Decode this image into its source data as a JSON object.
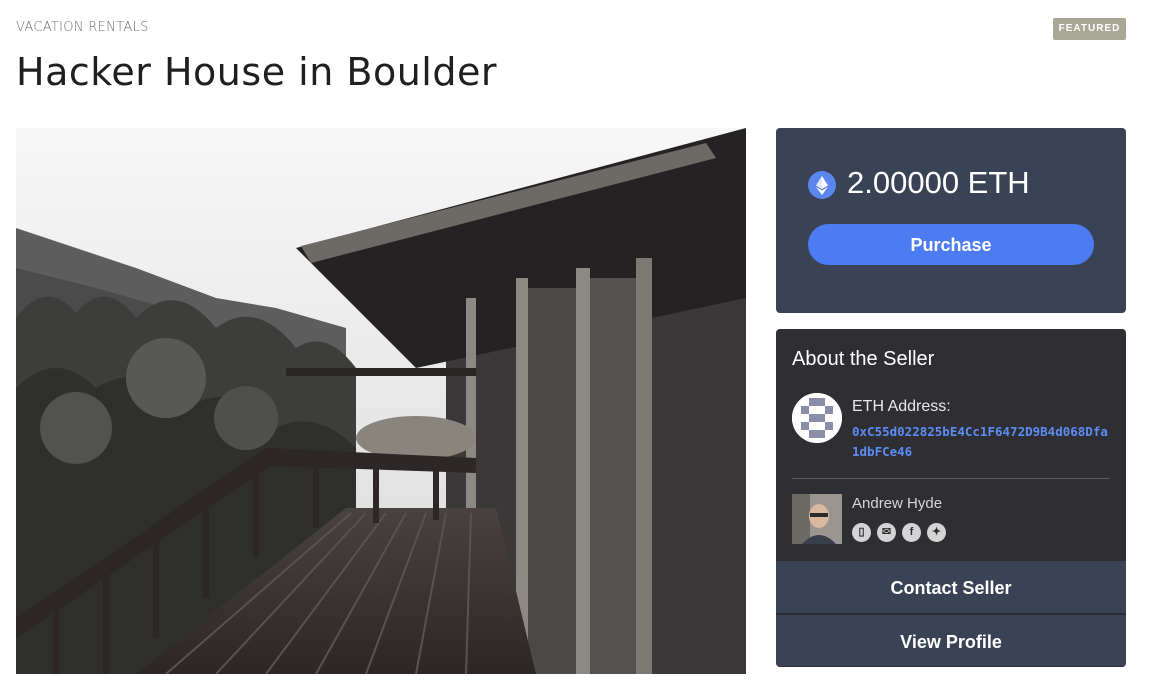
{
  "listing": {
    "category": "VACATION RENTALS",
    "badge": "FEATURED",
    "title": "Hacker House in Boulder",
    "image_icon": "listing-photo"
  },
  "price_card": {
    "currency_icon": "ethereum-icon",
    "price": "2.00000 ETH",
    "purchase_label": "Purchase",
    "accent_color": "#4d7cf2",
    "card_color": "#3a4256"
  },
  "seller": {
    "heading": "About the Seller",
    "eth_label": "ETH Address:",
    "eth_address": "0xC55d022825bE4Cc1F6472D9B4d068Dfa1dbFCe46",
    "name": "Andrew Hyde",
    "social_icons": [
      "phone-icon",
      "email-icon",
      "facebook-icon",
      "twitter-icon"
    ],
    "contact_label": "Contact Seller",
    "profile_label": "View Profile",
    "address_color": "#5c8df5",
    "card_color": "#2e2e33"
  }
}
